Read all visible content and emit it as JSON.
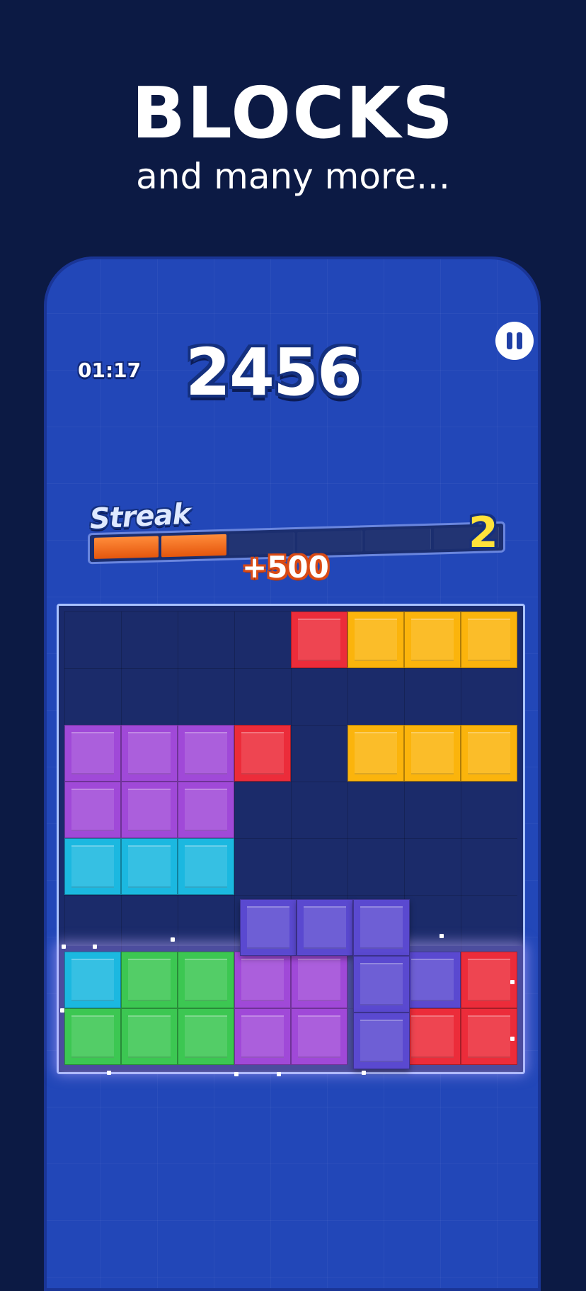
{
  "promo": {
    "headline": "BLOCKS",
    "subheadline": "and many more..."
  },
  "hud": {
    "timer": "01:17",
    "score": "2456",
    "pause_icon": "pause-icon"
  },
  "streak": {
    "label": "Streak",
    "count": "2",
    "bonus": "+500",
    "segments_total": 6,
    "segments_filled": 2
  },
  "colors": {
    "background": "#0c1a44",
    "phone": "#2247b8",
    "red": "#ec2c3a",
    "yellow": "#fbb40c",
    "purple": "#a049d8",
    "cyan": "#1bb8e0",
    "green": "#3cc752",
    "indigo": "#5a49d0"
  },
  "board": {
    "cols": 8,
    "rows": 8,
    "grid": [
      [
        ".",
        ".",
        ".",
        ".",
        "R",
        "Y",
        "Y",
        "Y"
      ],
      [
        ".",
        ".",
        ".",
        ".",
        ".",
        ".",
        ".",
        "."
      ],
      [
        "P",
        "P",
        "P",
        "R",
        ".",
        "Y",
        "Y",
        "Y"
      ],
      [
        "P",
        "P",
        "P",
        ".",
        ".",
        ".",
        ".",
        "."
      ],
      [
        "C",
        "C",
        "C",
        ".",
        ".",
        ".",
        ".",
        "."
      ],
      [
        ".",
        ".",
        ".",
        ".",
        ".",
        ".",
        ".",
        "."
      ],
      [
        "C",
        "G",
        "G",
        "P",
        "P",
        ".",
        "I",
        "R"
      ],
      [
        "G",
        "G",
        "G",
        "P",
        "P",
        ".",
        "R",
        "R"
      ]
    ],
    "highlighted_rows": [
      6,
      7
    ],
    "held_piece": {
      "color": "I",
      "cells": [
        [
          5,
          3
        ],
        [
          5,
          4
        ],
        [
          5,
          5
        ],
        [
          6,
          5
        ],
        [
          7,
          5
        ]
      ]
    }
  }
}
